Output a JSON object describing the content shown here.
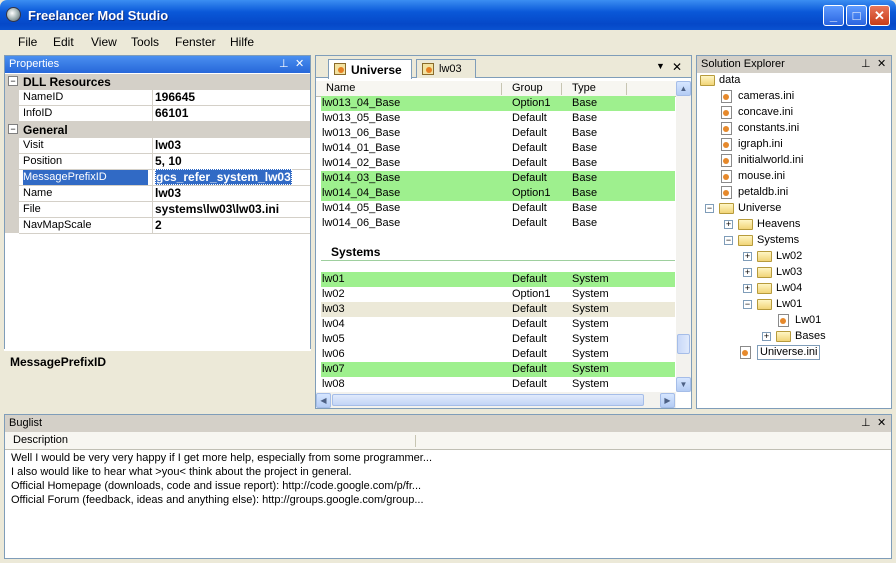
{
  "window": {
    "title": "Freelancer Mod Studio"
  },
  "menu": [
    "File",
    "Edit",
    "View",
    "Tools",
    "Fenster",
    "Hilfe"
  ],
  "properties": {
    "title": "Properties",
    "categories": [
      {
        "name": "DLL Resources",
        "rows": [
          {
            "key": "NameID",
            "value": "196645"
          },
          {
            "key": "InfoID",
            "value": "66101"
          }
        ]
      },
      {
        "name": "General",
        "rows": [
          {
            "key": "Visit",
            "value": "lw03"
          },
          {
            "key": "Position",
            "value": "5, 10"
          },
          {
            "key": "MessagePrefixID",
            "value": "gcs_refer_system_lw03"
          },
          {
            "key": "Name",
            "value": "lw03"
          },
          {
            "key": "File",
            "value": "systems\\lw03\\lw03.ini"
          },
          {
            "key": "NavMapScale",
            "value": "2"
          }
        ]
      }
    ],
    "selected_key": "MessagePrefixID",
    "description_title": "MessagePrefixID"
  },
  "document": {
    "tabs": [
      {
        "label": "Universe",
        "active": true
      },
      {
        "label": "lw03",
        "active": false
      }
    ],
    "columns": [
      "Name",
      "Group",
      "Type"
    ],
    "base_rows": [
      {
        "name": "lw013_04_Base",
        "group": "Option1",
        "type": "Base",
        "hl": "green"
      },
      {
        "name": "lw013_05_Base",
        "group": "Default",
        "type": "Base",
        "hl": ""
      },
      {
        "name": "lw013_06_Base",
        "group": "Default",
        "type": "Base",
        "hl": ""
      },
      {
        "name": "lw014_01_Base",
        "group": "Default",
        "type": "Base",
        "hl": ""
      },
      {
        "name": "lw014_02_Base",
        "group": "Default",
        "type": "Base",
        "hl": ""
      },
      {
        "name": "lw014_03_Base",
        "group": "Default",
        "type": "Base",
        "hl": "green"
      },
      {
        "name": "lw014_04_Base",
        "group": "Option1",
        "type": "Base",
        "hl": "green"
      },
      {
        "name": "lw014_05_Base",
        "group": "Default",
        "type": "Base",
        "hl": ""
      },
      {
        "name": "lw014_06_Base",
        "group": "Default",
        "type": "Base",
        "hl": ""
      }
    ],
    "systems_header": "Systems",
    "system_rows": [
      {
        "name": "lw01",
        "group": "Default",
        "type": "System",
        "hl": "green"
      },
      {
        "name": "lw02",
        "group": "Option1",
        "type": "System",
        "hl": ""
      },
      {
        "name": "lw03",
        "group": "Default",
        "type": "System",
        "hl": "grey"
      },
      {
        "name": "lw04",
        "group": "Default",
        "type": "System",
        "hl": ""
      },
      {
        "name": "lw05",
        "group": "Default",
        "type": "System",
        "hl": ""
      },
      {
        "name": "lw06",
        "group": "Default",
        "type": "System",
        "hl": ""
      },
      {
        "name": "lw07",
        "group": "Default",
        "type": "System",
        "hl": "green"
      },
      {
        "name": "lw08",
        "group": "Default",
        "type": "System",
        "hl": ""
      }
    ]
  },
  "solution": {
    "title": "Solution Explorer",
    "nodes": [
      {
        "label": "data",
        "kind": "folder",
        "level": 0,
        "exp": "",
        "y": 0
      },
      {
        "label": "cameras.ini",
        "kind": "file",
        "level": 1,
        "exp": ""
      },
      {
        "label": "concave.ini",
        "kind": "file",
        "level": 1,
        "exp": ""
      },
      {
        "label": "constants.ini",
        "kind": "file",
        "level": 1,
        "exp": ""
      },
      {
        "label": "igraph.ini",
        "kind": "file",
        "level": 1,
        "exp": ""
      },
      {
        "label": "initialworld.ini",
        "kind": "file",
        "level": 1,
        "exp": ""
      },
      {
        "label": "mouse.ini",
        "kind": "file",
        "level": 1,
        "exp": ""
      },
      {
        "label": "petaldb.ini",
        "kind": "file",
        "level": 1,
        "exp": ""
      },
      {
        "label": "Universe",
        "kind": "folder",
        "level": 1,
        "exp": "-"
      },
      {
        "label": "Heavens",
        "kind": "folder",
        "level": 2,
        "exp": "+"
      },
      {
        "label": "Systems",
        "kind": "folder",
        "level": 2,
        "exp": "-"
      },
      {
        "label": "Lw02",
        "kind": "folder",
        "level": 3,
        "exp": "+"
      },
      {
        "label": "Lw03",
        "kind": "folder",
        "level": 3,
        "exp": "+"
      },
      {
        "label": "Lw04",
        "kind": "folder",
        "level": 3,
        "exp": "+"
      },
      {
        "label": "Lw01",
        "kind": "folder",
        "level": 3,
        "exp": "-"
      },
      {
        "label": "Lw01",
        "kind": "file",
        "level": 4,
        "exp": ""
      },
      {
        "label": "Bases",
        "kind": "folder",
        "level": 4,
        "exp": "+"
      },
      {
        "label": "Universe.ini",
        "kind": "file",
        "level": 2,
        "exp": "",
        "selected": true
      }
    ]
  },
  "buglist": {
    "title": "Buglist",
    "column": "Description",
    "lines": [
      "Well I would be very very happy if I get more help, especially from some programmer...",
      "I also would like to hear what >you< think about the project in general.",
      "Official Homepage (downloads, code and issue report): http://code.google.com/p/fr...",
      "Official Forum (feedback, ideas and anything else): http://groups.google.com/group..."
    ]
  },
  "colors": {
    "accent": "#316ac5",
    "highlight_green": "#9ef08e",
    "panel_header": "#2767d9"
  }
}
